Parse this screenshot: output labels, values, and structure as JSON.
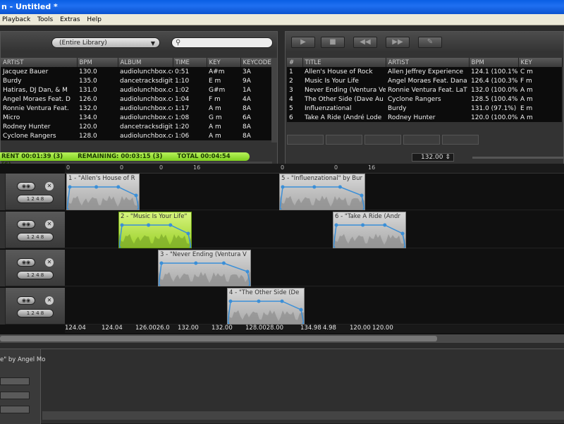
{
  "window": {
    "title": "n - Untitled *"
  },
  "menu": [
    "Playback",
    "Tools",
    "Extras",
    "Help"
  ],
  "library": {
    "source": "(Entire Library)",
    "columns": [
      "ARTIST",
      "BPM",
      "ALBUM",
      "TIME",
      "KEY",
      "KEYCODE"
    ],
    "rows": [
      [
        "Jacquez Bauer",
        "130.0",
        "audiolunchbox.cc",
        "0:51",
        "A#m",
        "3A"
      ],
      [
        "Burdy",
        "135.0",
        "dancetracksdigit",
        "1:10",
        "E m",
        "9A"
      ],
      [
        "Hatiras, DJ Dan, & M",
        "131.0",
        "audiolunchbox.cc",
        "1:02",
        "G#m",
        "1A"
      ],
      [
        "Angel Moraes Feat. D",
        "126.0",
        "audiolunchbox.cc",
        "1:04",
        "F m",
        "4A"
      ],
      [
        "Ronnie Ventura Feat.",
        "132.0",
        "audiolunchbox.cc",
        "1:17",
        "A m",
        "8A"
      ],
      [
        "Micro",
        "134.0",
        "audiolunchbox.cc",
        "1:08",
        "G m",
        "6A"
      ],
      [
        "Rodney Hunter",
        "120.0",
        "dancetracksdigit",
        "1:20",
        "A m",
        "8A"
      ],
      [
        "Cyclone Rangers",
        "128.0",
        "audiolunchbox.cc",
        "1:06",
        "A m",
        "8A"
      ]
    ]
  },
  "playlist": {
    "columns": [
      "#",
      "TITLE",
      "ARTIST",
      "BPM",
      "KEY"
    ],
    "rows": [
      [
        "1",
        "Allen's House of Rock",
        "Allen Jeffrey Experience",
        "124.1 (100.1%",
        "C m"
      ],
      [
        "2",
        "Music Is Your Life",
        "Angel Moraes Feat. Dana",
        "126.4 (100.3%",
        "F m"
      ],
      [
        "3",
        "Never Ending (Ventura Ve",
        "Ronnie Ventura Feat. LaT",
        "132.0 (100.0%",
        "A m"
      ],
      [
        "4",
        "The Other Side (Dave Au",
        "Cyclone Rangers",
        "128.5 (100.4%",
        "A m"
      ],
      [
        "5",
        "Influenzational",
        "Burdy",
        "131.0 (97.1%)",
        "E m"
      ],
      [
        "6",
        "Take A Ride (André Lode",
        "Rodney Hunter",
        "120.0 (100.0%",
        "A m"
      ]
    ]
  },
  "status": {
    "current": "RENT 00:01:39 (3)",
    "remaining": "REMAINING: 00:03:15 (3)",
    "total": "TOTAL 00:04:54 (6)",
    "bpm": "132.00"
  },
  "ruler_ticks": [
    "0",
    "0",
    "0",
    "16",
    "0",
    "0",
    "16"
  ],
  "clips": [
    {
      "label": "1 - \"Allen's House of R",
      "active": false
    },
    {
      "label": "2 - \"Music Is Your Life\"",
      "active": true
    },
    {
      "label": "3 - \"Never Ending (Ventura V",
      "active": false
    },
    {
      "label": "4 - \"The Other Side (De",
      "active": false
    },
    {
      "label": "5 - \"Influenzational\" by Bur",
      "active": false
    },
    {
      "label": "6 - \"Take A Ride (Andr",
      "active": false
    }
  ],
  "bpm_axis": [
    "124.04",
    "124.04",
    "126.0026.0",
    "132.00",
    "132.00",
    "128.0028.00",
    "134.98",
    "4.98",
    "120.00",
    "120.00"
  ],
  "bottom": {
    "now_playing": "e\" by Angel Mo"
  },
  "icons": [
    "play-icon",
    "stop-icon",
    "prev-icon",
    "next-icon",
    "search-icon",
    "close-icon"
  ]
}
